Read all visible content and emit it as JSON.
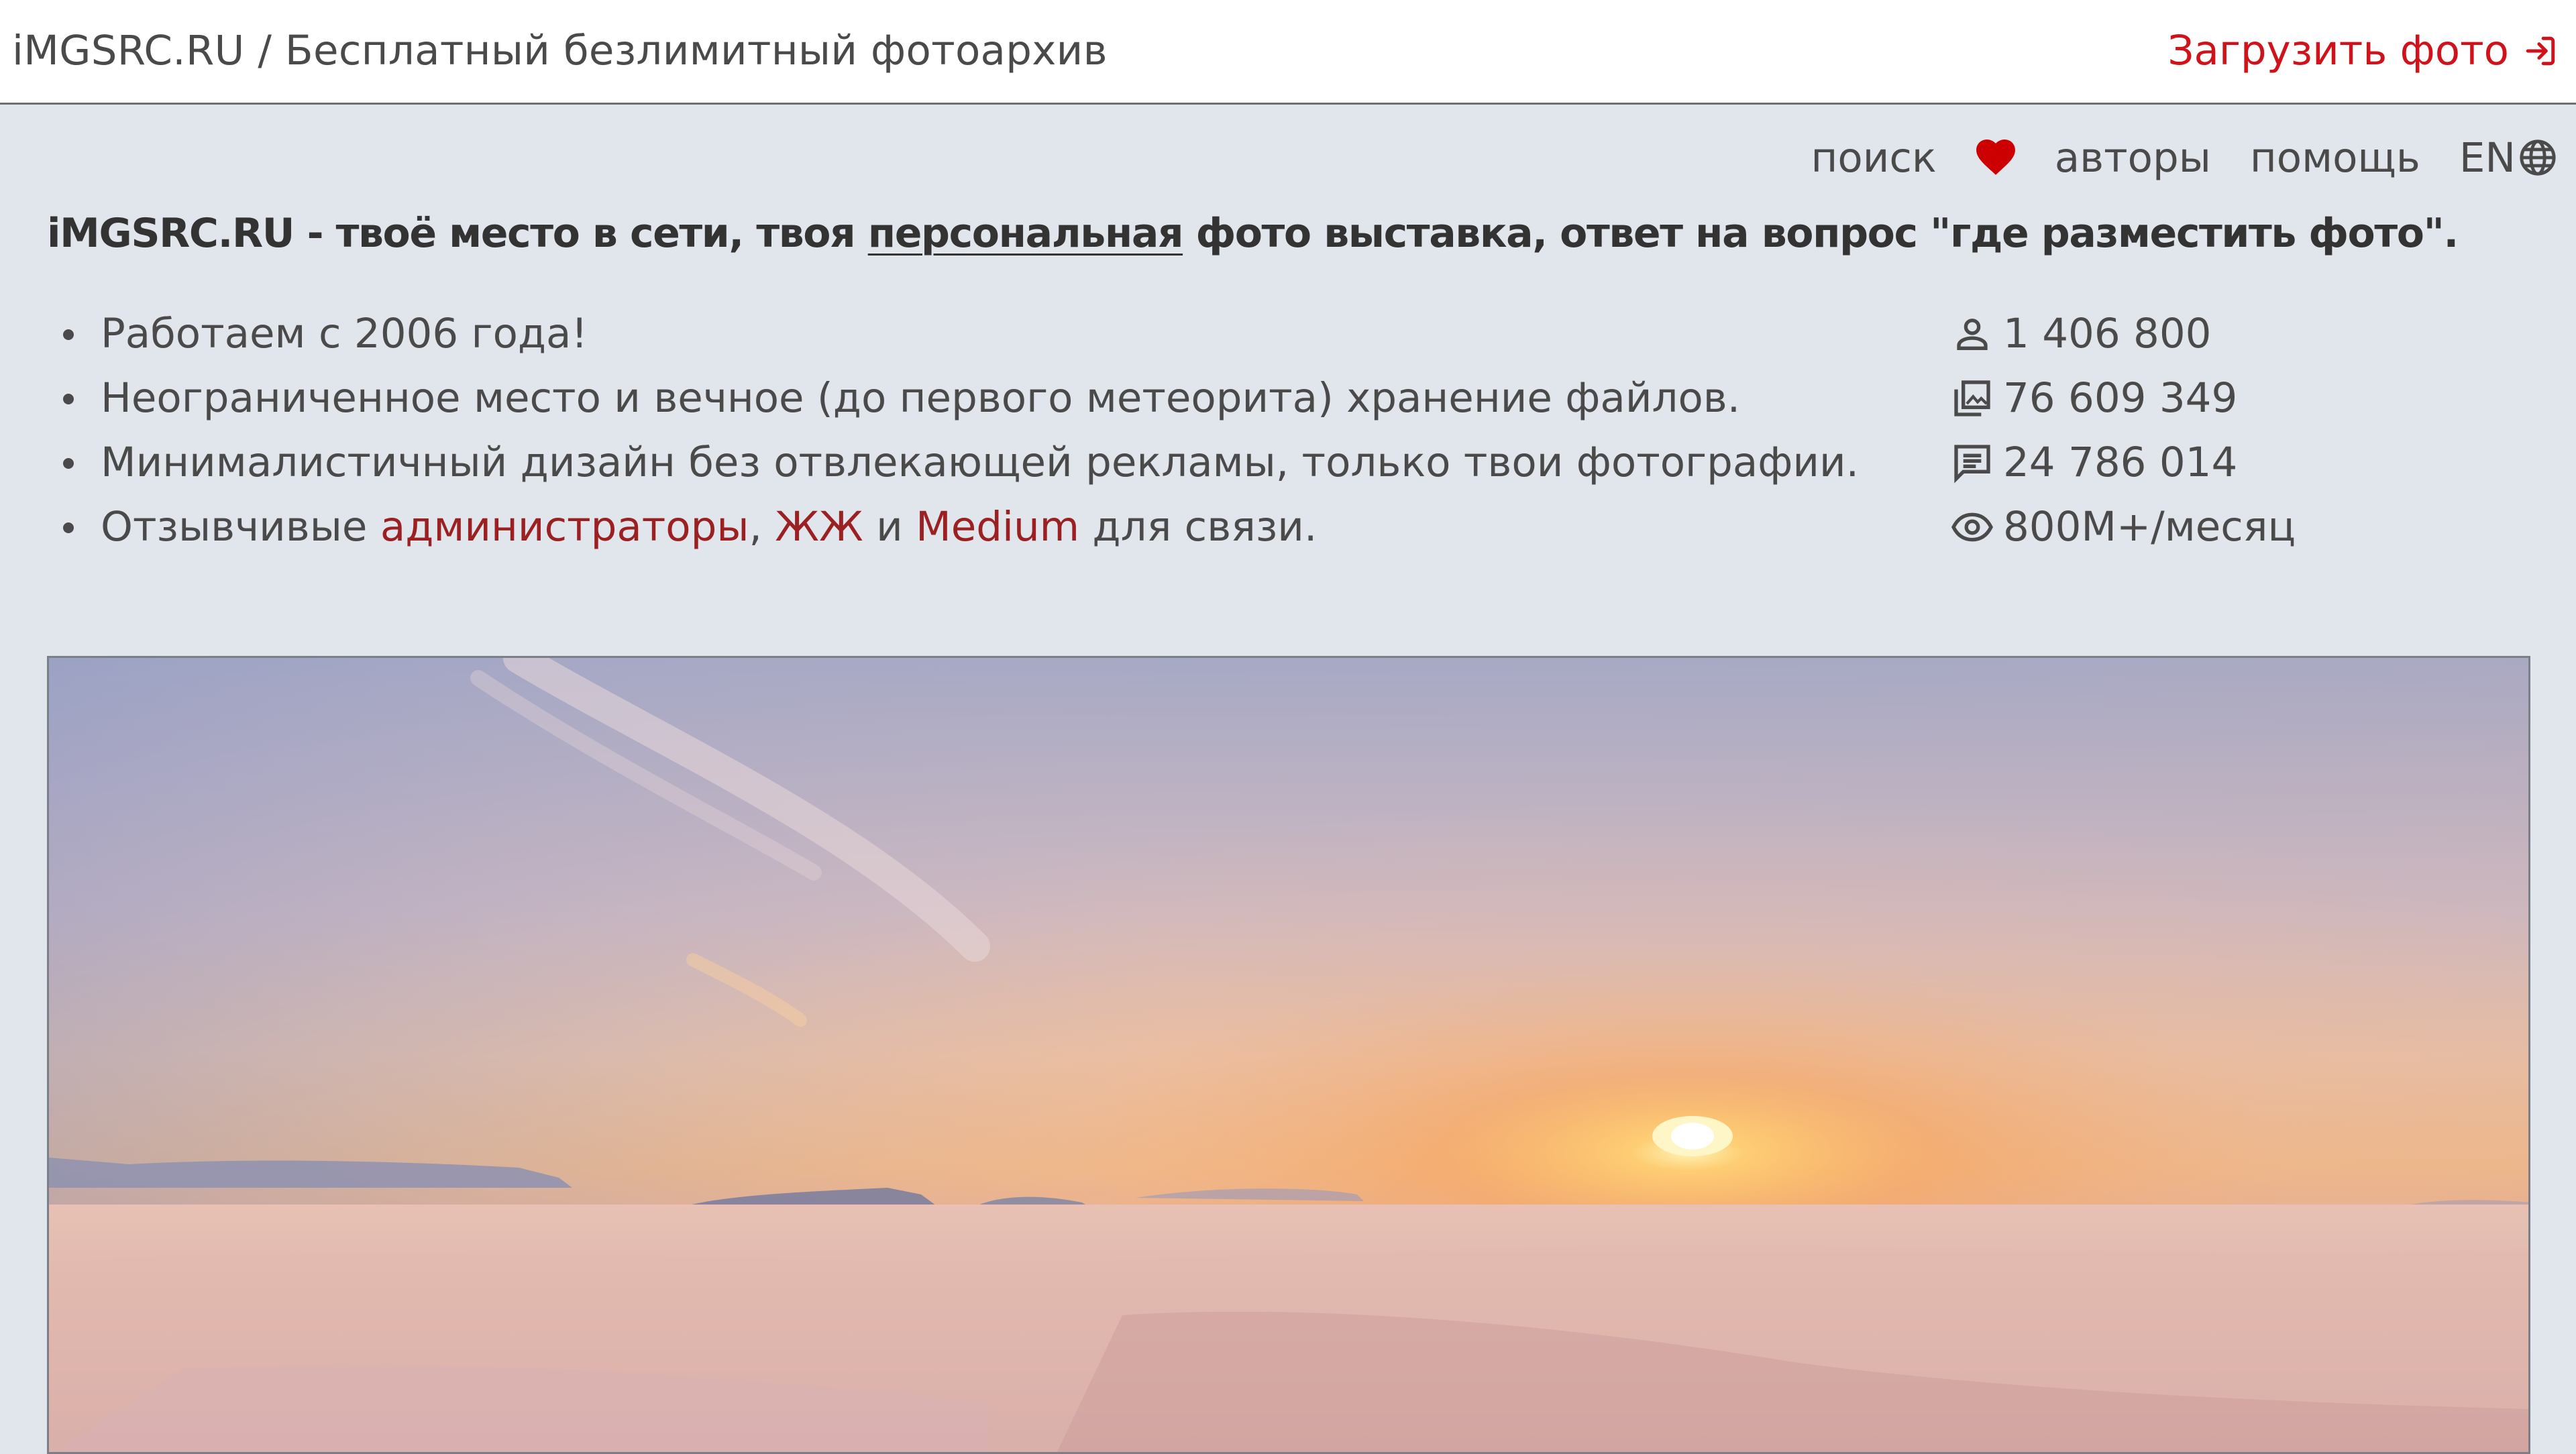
{
  "header": {
    "site_title": "iMGSRC.RU / Бесплатный безлимитный фотоархив",
    "upload_label": "Загрузить фото",
    "upload_icon": "login-arrow-icon"
  },
  "nav": {
    "search": "поиск",
    "favorites_icon": "heart-icon",
    "authors": "авторы",
    "help": "помощь",
    "language": "EN",
    "language_icon": "globe-icon"
  },
  "tagline": {
    "part1": "iMGSRC.RU - твоё место в сети, твоя ",
    "link": "персональная",
    "part2": " фото выставка, ответ на вопрос \"где разместить фото\"."
  },
  "features": [
    {
      "text": "Работаем с 2006 года!"
    },
    {
      "text": "Неограниченное место и вечное (до первого метеорита) хранение файлов."
    },
    {
      "text": "Минималистичный дизайн без отвлекающей рекламы, только твои фотографии."
    },
    {
      "prefix": "Отзывчивые ",
      "link1": "администраторы",
      "sep1": ", ",
      "link2": "ЖЖ",
      "sep2": " и ",
      "link3": "Medium",
      "suffix": " для связи."
    }
  ],
  "stats": [
    {
      "icon": "user-icon",
      "value": "1 406 800"
    },
    {
      "icon": "photo-library-icon",
      "value": "76 609 349"
    },
    {
      "icon": "comment-icon",
      "value": "24 786 014"
    },
    {
      "icon": "eye-icon",
      "value": "800M+/месяц"
    }
  ],
  "colors": {
    "accent_red": "#d0121b",
    "link_red": "#9b2021",
    "page_background": "#e1e6ec",
    "header_background": "#ffffff"
  },
  "hero": {
    "subject": "sunrise over sea of fog photo"
  }
}
